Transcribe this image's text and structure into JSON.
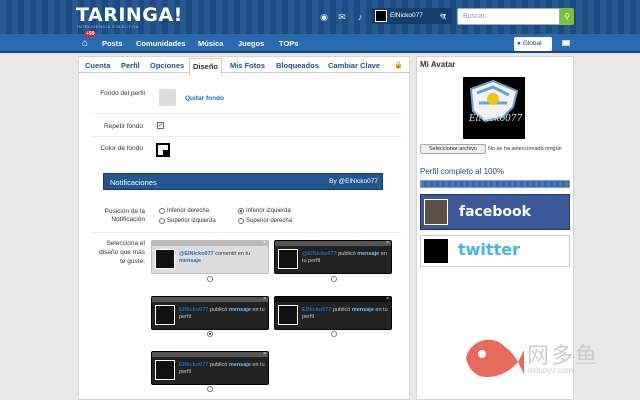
{
  "header": {
    "logo": "TARINGA!",
    "tagline": "INTELIGENCIA COLECTIVA",
    "user_name": "ElNicko077",
    "search_placeholder": "Buscar...",
    "icons": [
      "eye-icon",
      "mail-icon",
      "bell-icon",
      "edit-icon",
      "search-icon"
    ]
  },
  "nav": {
    "badge": "+99",
    "items": [
      "Posts",
      "Comunidades",
      "Música",
      "Juegos",
      "TOPs"
    ],
    "global_label": "Global"
  },
  "tabs": [
    "Cuenta",
    "Perfil",
    "Opciones",
    "Diseño",
    "Mis Fotos",
    "Bloqueados",
    "Cambiar Clave"
  ],
  "active_tab": "Diseño",
  "form": {
    "bg_label": "Fondo del perfil",
    "bg_link": "Quitar fondo",
    "repeat_label": "Repetir fondo",
    "repeat_checked": true,
    "color_label": "Color de fondo",
    "notif_title": "Notificaciones",
    "notif_by": "By @ElNicko077",
    "pos_label_1": "Posición de la",
    "pos_label_2": "Notificación",
    "pos_options": [
      "Inferior derecha",
      "Inferior izquierda",
      "Superior izquierda",
      "Superior derecha"
    ],
    "pos_selected": "Inferior izquierda",
    "theme_label_1": "Selecciona el",
    "theme_label_2": "diseño que más",
    "theme_label_3": "te guste.",
    "theme_user": "@ElNicko077",
    "theme_text_1": "comentó en tu",
    "theme_text_2": "mensaje",
    "theme_text_3": "publicó",
    "theme_text_4": "en tu perfil",
    "theme_user_short": "ElNicko077",
    "theme_text_5": "en tu perfil"
  },
  "sidebar": {
    "title": "Mi Avatar",
    "file_button": "Seleccionar archivo",
    "file_status": "No se ha seleccionado ningún",
    "profile_complete": "Perfil completo al 100%",
    "progress_percent": 100,
    "facebook": "facebook",
    "twitter": "twitter"
  },
  "watermark": {
    "cn": "网多鱼",
    "url": "wduoyu.com"
  },
  "colors": {
    "header": "#1d4f8a",
    "nav": "#2a6bb0",
    "facebook": "#3b5998",
    "twitter": "#3fb6e6",
    "search_btn": "#7bbf3a"
  }
}
